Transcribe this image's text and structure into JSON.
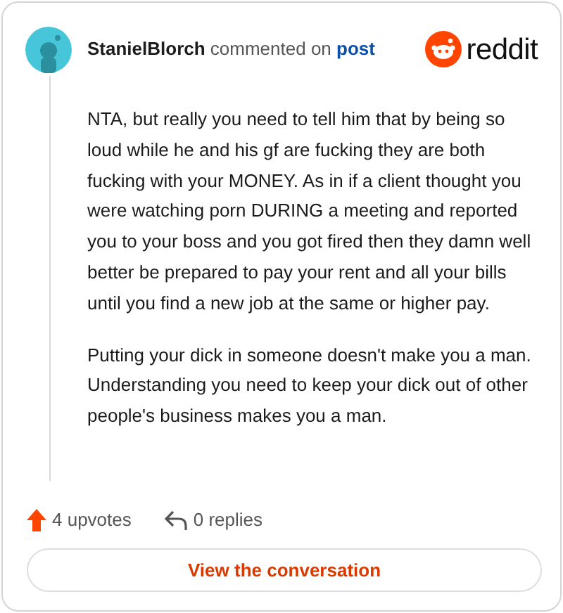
{
  "comment": {
    "author": "StanielBlorch",
    "action": "commented on",
    "target": "post",
    "brand": "reddit",
    "paragraphs": [
      "NTA, but really you need to tell him that by being so loud while he and his gf are fucking they are both fucking with your MONEY. As in if a client thought you were watching porn DURING a meeting and reported you to your boss and you got fired then they damn well better be prepared to pay your rent and all your bills until you find a new job at the same or higher pay.",
      "Putting your dick in someone doesn't make you a man. Understanding you need to keep your dick out of other people's business makes you a man."
    ],
    "upvotes": "4 upvotes",
    "replies": "0 replies"
  },
  "button": "View the conversation"
}
